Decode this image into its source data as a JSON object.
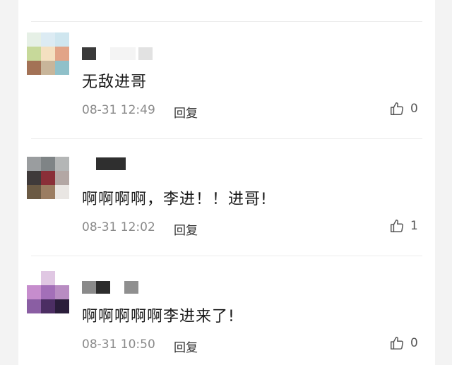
{
  "comments": [
    {
      "text": "无敌进哥",
      "time": "08-31 12:49",
      "reply_label": "回复",
      "likes": "0",
      "avatar_colors": [
        "#e6f0e6",
        "#dcebf3",
        "#cfe6ef",
        "#c7d99a",
        "#f4e0c0",
        "#e2a487",
        "#a37256",
        "#c8b59a",
        "#8fc0c9"
      ]
    },
    {
      "text": "啊啊啊啊，李进！！进哥!",
      "time": "08-31 12:02",
      "reply_label": "回复",
      "likes": "1",
      "avatar_colors": [
        "#9a9d9f",
        "#7f8486",
        "#b4b6b6",
        "#3f3a3a",
        "#8a2f38",
        "#b3a7a4",
        "#6b5a44",
        "#9b7d62",
        "#e9e6e3"
      ]
    },
    {
      "text": "啊啊啊啊啊李进来了!",
      "time": "08-31 10:50",
      "reply_label": "回复",
      "likes": "0",
      "avatar_colors": [
        "#ffffff",
        "#e0c7e3",
        "#ffffff",
        "#c68dcd",
        "#a36fb8",
        "#b88cc2",
        "#8a5ea3",
        "#4c2e63",
        "#2a1d3a"
      ]
    }
  ],
  "colors": {
    "divider": "#ececec",
    "meta_text": "#8a8a8a",
    "like_icon": "#555555"
  }
}
